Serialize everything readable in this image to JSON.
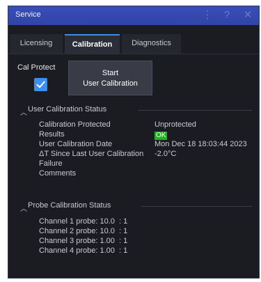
{
  "window": {
    "title": "Service",
    "buttons": {
      "menu_glyph": "⋮",
      "help_glyph": "?",
      "close_glyph": "✕"
    }
  },
  "tabs": [
    {
      "label": "Licensing",
      "active": false
    },
    {
      "label": "Calibration",
      "active": true
    },
    {
      "label": "Diagnostics",
      "active": false
    }
  ],
  "cal_protect": {
    "label": "Cal Protect",
    "checked": true,
    "checkmark": "✓"
  },
  "start_button": {
    "line1": "Start",
    "line2": "User Calibration"
  },
  "user_cal_status": {
    "header": "User Calibration Status",
    "rows": [
      {
        "label": "Calibration Protected",
        "value": "Unprotected"
      },
      {
        "label": "Results",
        "value": "OK"
      },
      {
        "label": "User Calibration Date",
        "value": "Mon Dec 18 18:03:44 2023"
      },
      {
        "label": "ΔT Since Last User Calibration",
        "value": "-2.0°C"
      },
      {
        "label": "Failure",
        "value": ""
      },
      {
        "label": "Comments",
        "value": ""
      }
    ]
  },
  "probe_cal_status": {
    "header": "Probe Calibration Status",
    "lines": [
      "Channel 1 probe: 10.0  : 1",
      "Channel 2 probe: 10.0  : 1",
      "Channel 3 probe: 1.00  : 1",
      "Channel 4 probe: 1.00  : 1"
    ]
  },
  "colors": {
    "title_bar": "#2f43a8",
    "accent": "#3d8bea",
    "ok": "#1fb11f",
    "background": "#1b1c22"
  },
  "icons": {
    "chevron": "chevron-up-icon",
    "check": "checkmark-icon"
  }
}
